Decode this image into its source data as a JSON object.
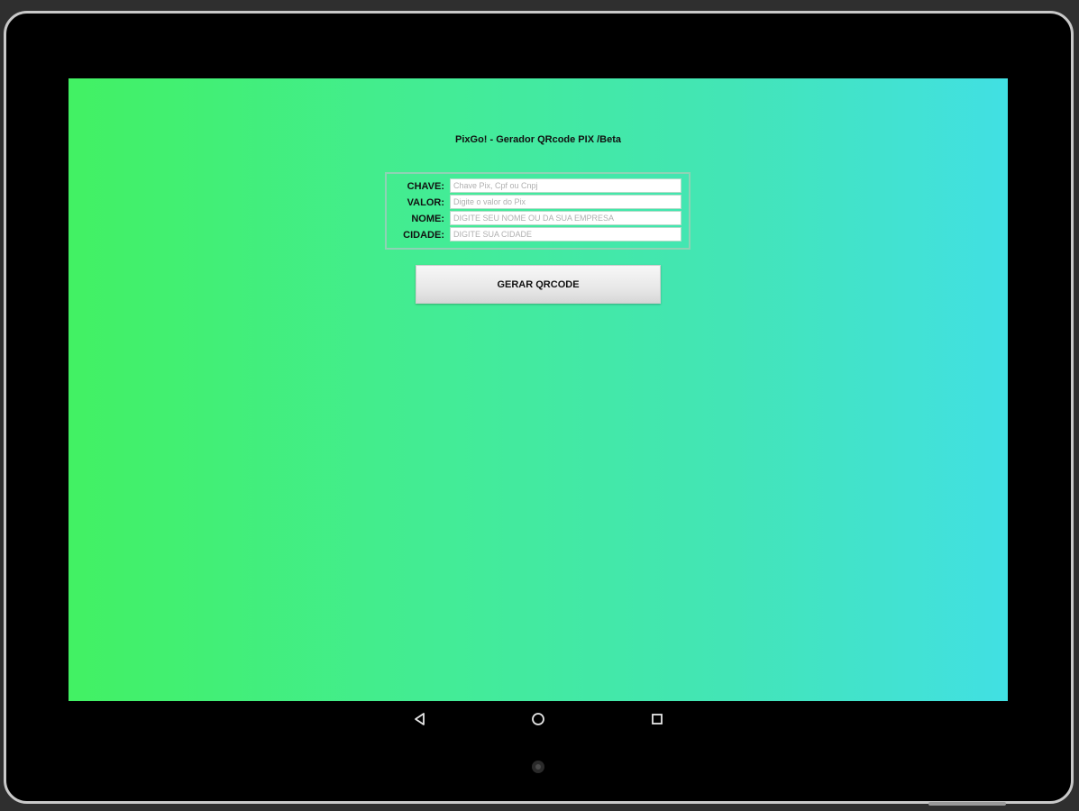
{
  "app": {
    "title": "PixGo! - Gerador QRcode PIX /Beta"
  },
  "form": {
    "fields": [
      {
        "label": "CHAVE:",
        "placeholder": "Chave Pix, Cpf ou Cnpj",
        "value": ""
      },
      {
        "label": "VALOR:",
        "placeholder": "Digite o valor do Pix",
        "value": ""
      },
      {
        "label": "NOME:",
        "placeholder": "DIGITE SEU NOME OU DA SUA EMPRESA",
        "value": ""
      },
      {
        "label": "CIDADE:",
        "placeholder": "DIGITE SUA CIDADE",
        "value": ""
      }
    ],
    "submit_label": "GERAR QRCODE"
  },
  "navbar": {
    "back_icon": "triangle-back-icon",
    "home_icon": "circle-home-icon",
    "recents_icon": "square-recents-icon"
  },
  "colors": {
    "gradient_start": "#42f163",
    "gradient_end": "#41e0e3"
  }
}
